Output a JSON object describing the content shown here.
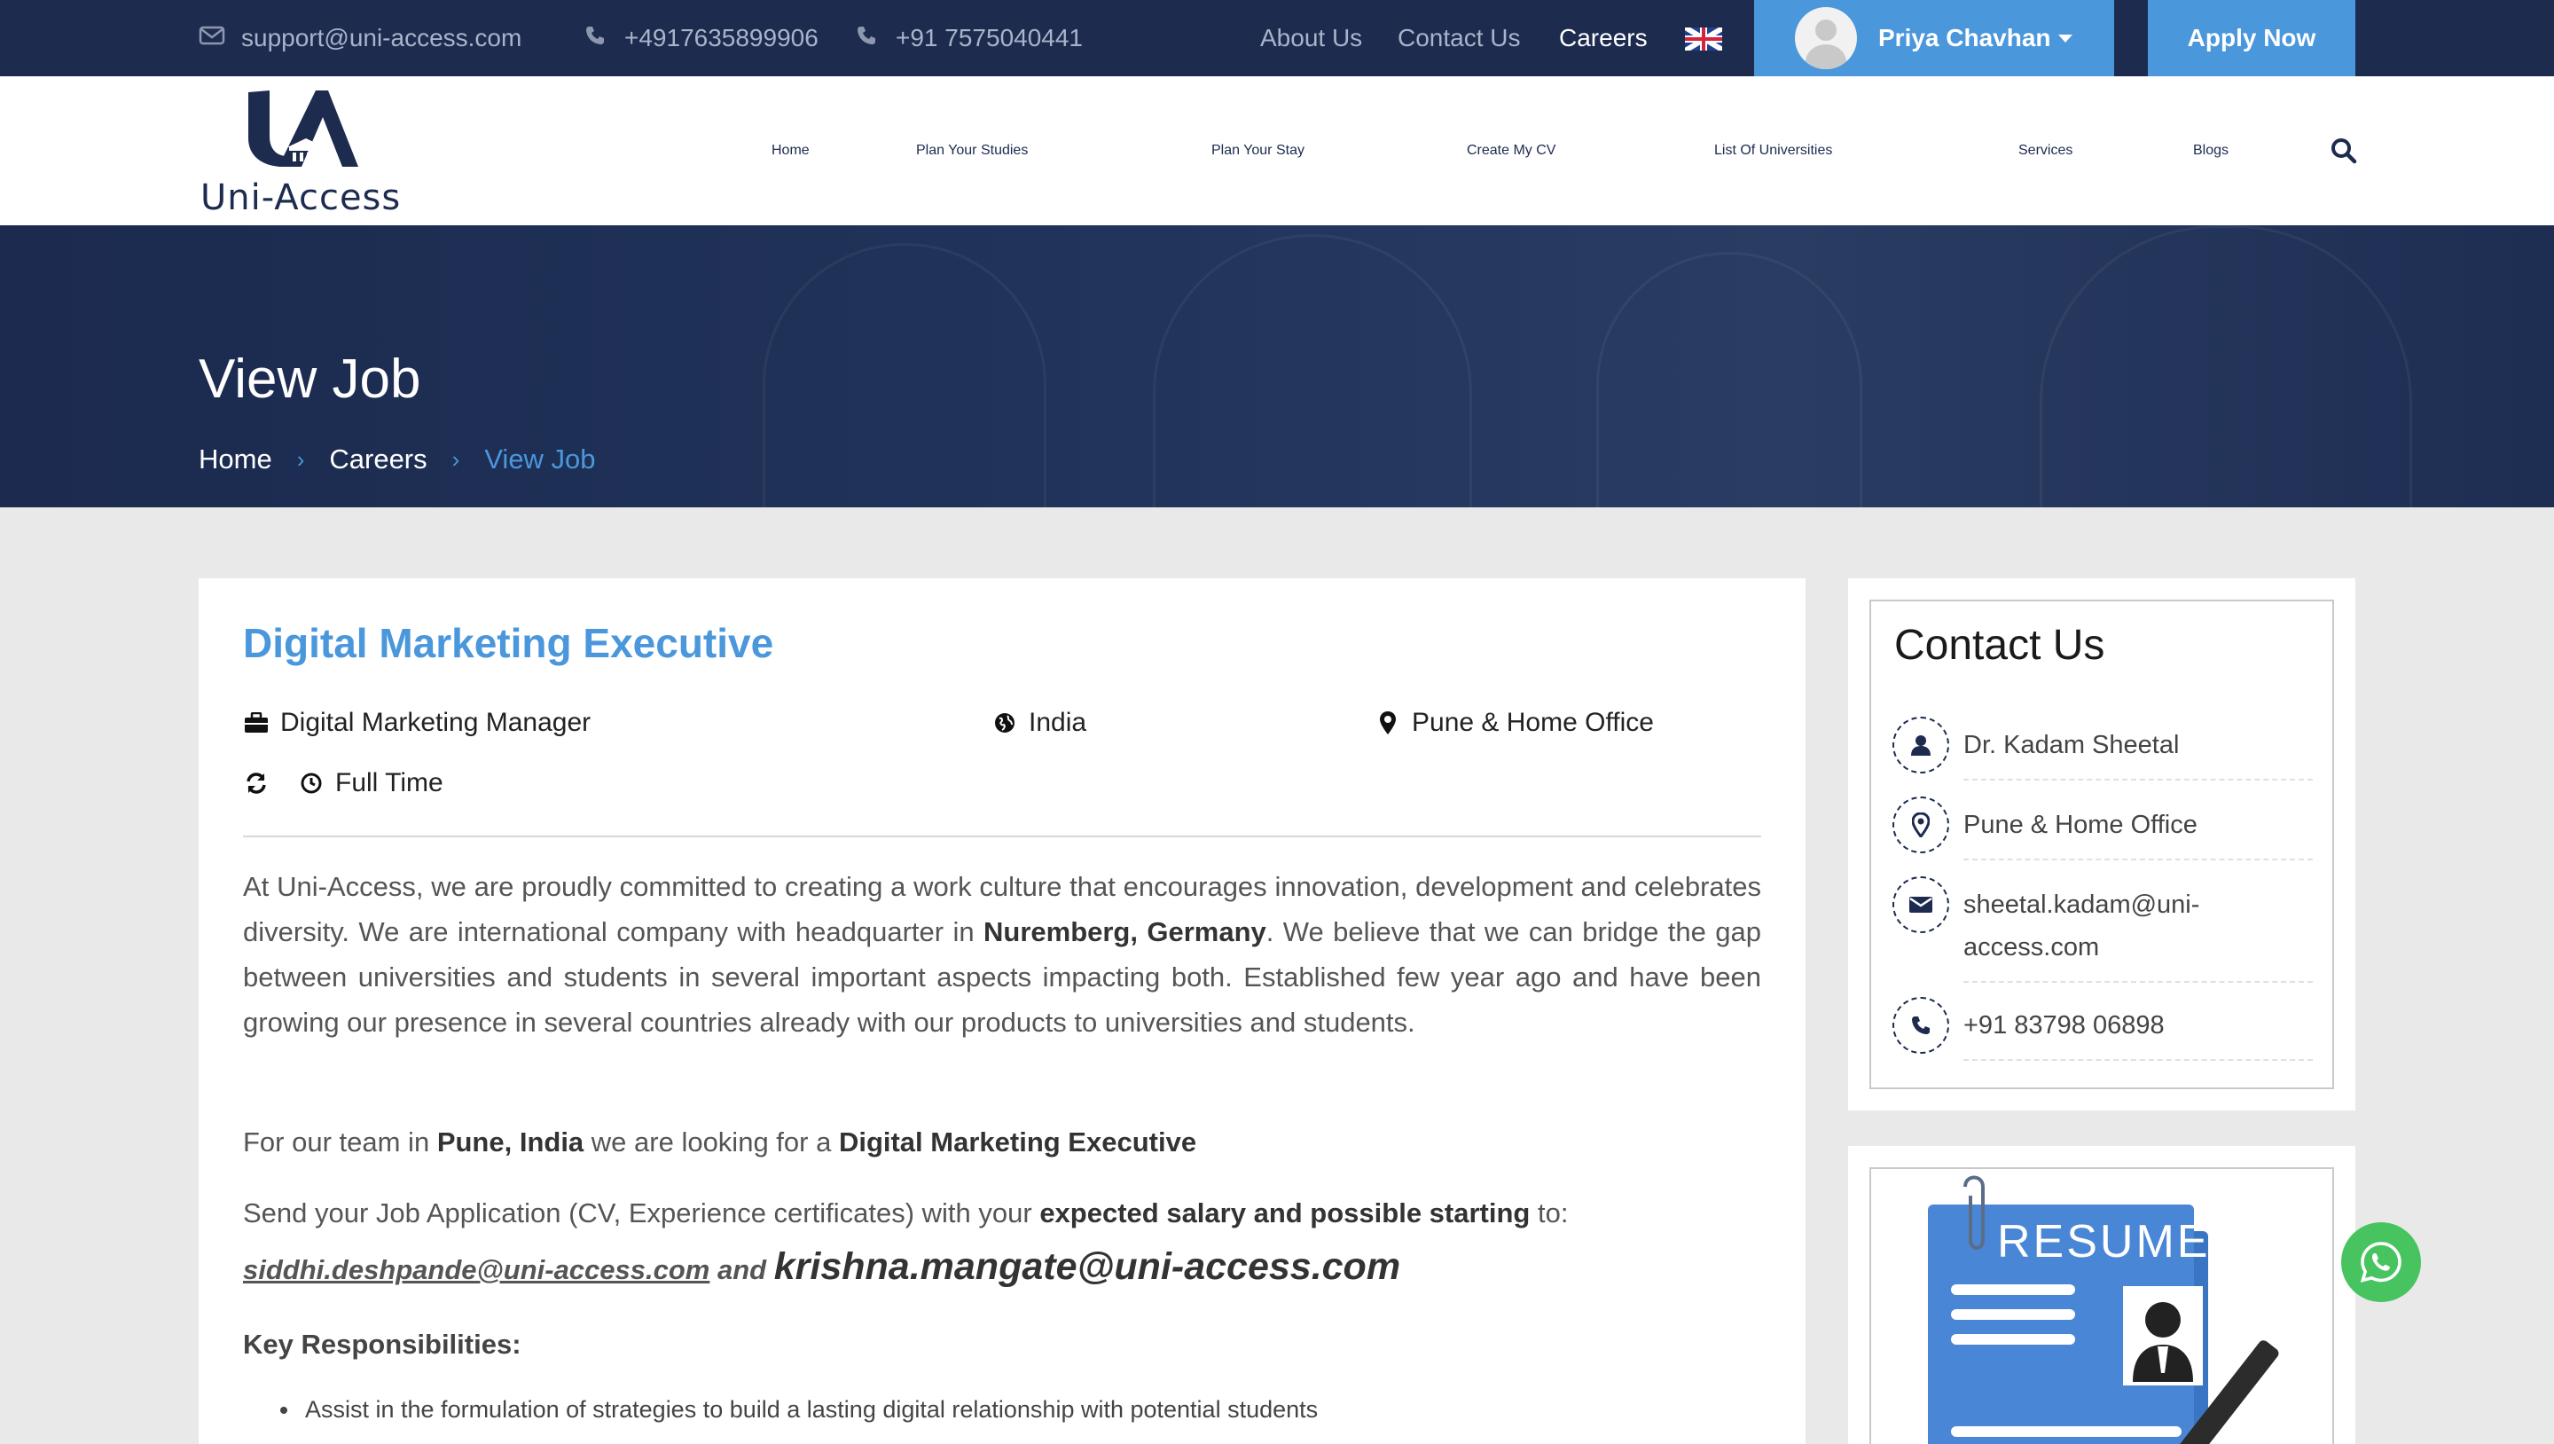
{
  "topbar": {
    "email": "support@uni-access.com",
    "phone1": "+4917635899906",
    "phone2": "+91 7575040441",
    "links": {
      "about": "About Us",
      "contact": "Contact Us",
      "careers": "Careers"
    },
    "user_name": "Priya Chavhan",
    "apply_label": "Apply Now"
  },
  "logo": {
    "brand": "Uni-Access"
  },
  "nav": {
    "home": "Home",
    "plan_studies": "Plan Your Studies",
    "plan_stay": "Plan Your Stay",
    "create_cv": "Create My CV",
    "universities": "List Of Universities",
    "services": "Services",
    "blogs": "Blogs"
  },
  "hero": {
    "title": "View Job",
    "breadcrumb": {
      "home": "Home",
      "careers": "Careers",
      "current": "View Job"
    }
  },
  "job": {
    "title": "Digital Marketing Executive",
    "department": "Digital Marketing Manager",
    "country": "India",
    "location": "Pune & Home Office",
    "type": "Full Time",
    "intro_1": "At Uni-Access, we are proudly committed to creating a work culture that encourages innovation, development and celebrates diversity. We are international company with headquarter in ",
    "hq": "Nuremberg, Germany",
    "intro_2": ". We believe that we can bridge the gap between universities and students in several important aspects impacting both. Established few year ago and have been growing our presence in several countries already with our products to universities and students.",
    "team_1": "For our team in ",
    "team_city": "Pune, India",
    "team_2": " we are looking for a ",
    "team_role": "Digital Marketing Executive",
    "send_1": "Send your Job Application (CV, Experience certificates) with your ",
    "send_bold": "expected salary and possible starting",
    "send_2": " to:",
    "mail1": "siddhi.deshpande@uni-access.com",
    "and": "and",
    "mail2": "krishna.mangate@uni-access.com",
    "key_heading": "Key Responsibilities:",
    "responsibilities": [
      "Assist in the formulation of strategies to build a lasting digital relationship with potential students"
    ]
  },
  "contact": {
    "heading": "Contact Us",
    "name": "Dr. Kadam Sheetal",
    "location": "Pune & Home Office",
    "email": "sheetal.kadam@uni-access.com",
    "phone": "+91 83798 06898"
  },
  "resume_card": {
    "label": "RESUME"
  },
  "colors": {
    "navy": "#1d2b4f",
    "accent": "#4a97db",
    "whatsapp": "#47c45f"
  }
}
